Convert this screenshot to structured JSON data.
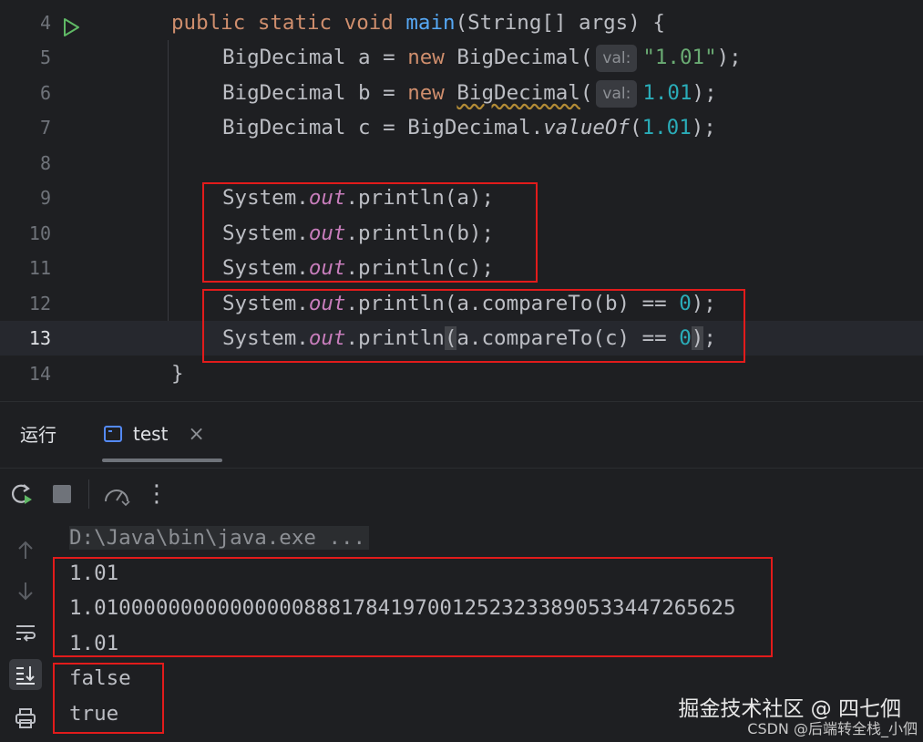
{
  "editor": {
    "line_numbers": [
      "4",
      "5",
      "6",
      "7",
      "8",
      "9",
      "10",
      "11",
      "12",
      "13",
      "14"
    ],
    "l4": {
      "kw1": "public",
      "kw2": "static",
      "kw3": "void",
      "fn": "main",
      "rest": "(String[] args) {"
    },
    "l5": {
      "a": "BigDecimal a = ",
      "kw": "new",
      "b": " BigDecimal(",
      "hint": "val:",
      "str": "\"1.01\"",
      "end": ");"
    },
    "l6": {
      "a": "BigDecimal b = ",
      "kw": "new",
      "sp": " ",
      "cls": "BigDecimal",
      "paren": "(",
      "hint": "val:",
      "num": "1.01",
      "end": ");"
    },
    "l7": {
      "a": "BigDecimal c = BigDecimal.",
      "m": "valueOf",
      "p": "(",
      "num": "1.01",
      "end": ");"
    },
    "sys": "System.",
    "out": "out",
    "l9": ".println(a);",
    "l10": ".println(b);",
    "l11": ".println(c);",
    "l12": {
      "a": ".println(a.compareTo(b) == ",
      "num": "0",
      "end": ");"
    },
    "l13": {
      "a": ".println",
      "p": "(",
      "b": "a.compareTo(c) == ",
      "num": "0",
      "end": ")",
      ";": ";"
    },
    "l14": "}"
  },
  "run": {
    "title": "运行",
    "tab_label": "test",
    "tab_close": "×",
    "more": "⋮",
    "console": {
      "cmd": "D:\\Java\\bin\\java.exe ...",
      "lines": [
        "1.01",
        "1.0100000000000000088817841970012523233890533447265625",
        "1.01",
        "false",
        "true"
      ]
    }
  },
  "watermark": {
    "line1": "掘金技术社区 @ 四七伵",
    "line2": "CSDN @后端转全栈_小伵"
  },
  "colors": {
    "background": "#1e1f22",
    "keyword": "#cf8e6d",
    "function": "#56a8f5",
    "string": "#6aab73",
    "number": "#2aacb8",
    "static_field": "#c77dbb",
    "highlight_box": "#e21b1b"
  }
}
